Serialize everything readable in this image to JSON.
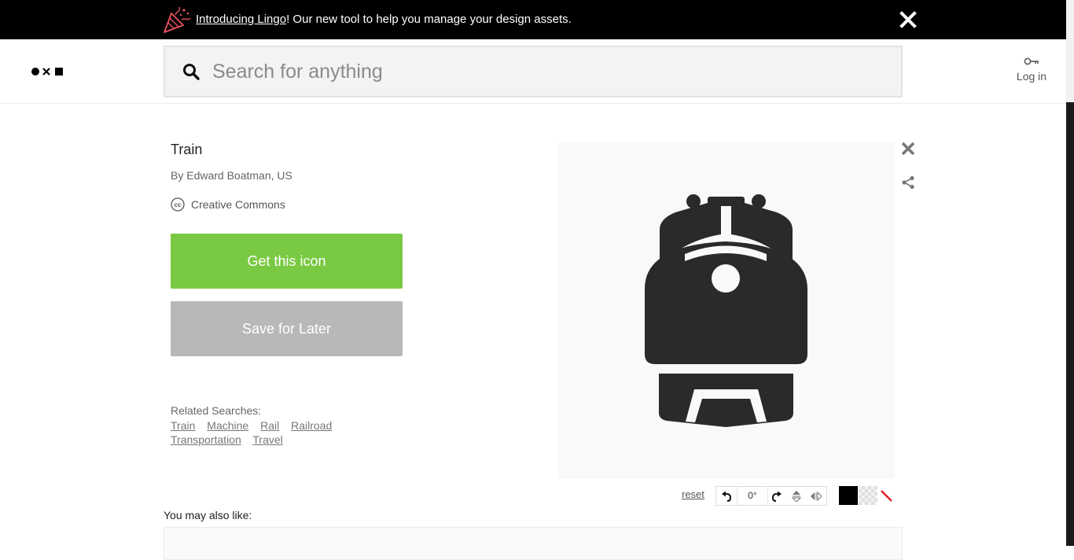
{
  "announcement": {
    "link_text": "Introducing Lingo",
    "message": "! Our new tool to help you manage your design assets.",
    "close_icon": "close-icon",
    "party_icon": "party-popper-icon"
  },
  "header": {
    "search_placeholder": "Search for anything",
    "login_label": "Log in",
    "login_icon": "key-icon"
  },
  "icon_detail": {
    "title": "Train",
    "author": "By Edward Boatman, US",
    "license": "Creative Commons",
    "get_button": "Get this icon",
    "save_button": "Save for Later"
  },
  "related": {
    "heading": "Related Searches:",
    "tags": [
      "Train",
      "Machine",
      "Rail",
      "Railroad",
      "Transportation",
      "Travel"
    ]
  },
  "toolbar": {
    "reset": "reset",
    "rotation": "0°"
  },
  "also_like": {
    "heading": "You may also like:"
  },
  "colors": {
    "primary_button": "#7ac943",
    "disabled_button": "#b8b8b8",
    "icon_fill": "#2a2a2a",
    "announcement_bg": "#000000"
  }
}
